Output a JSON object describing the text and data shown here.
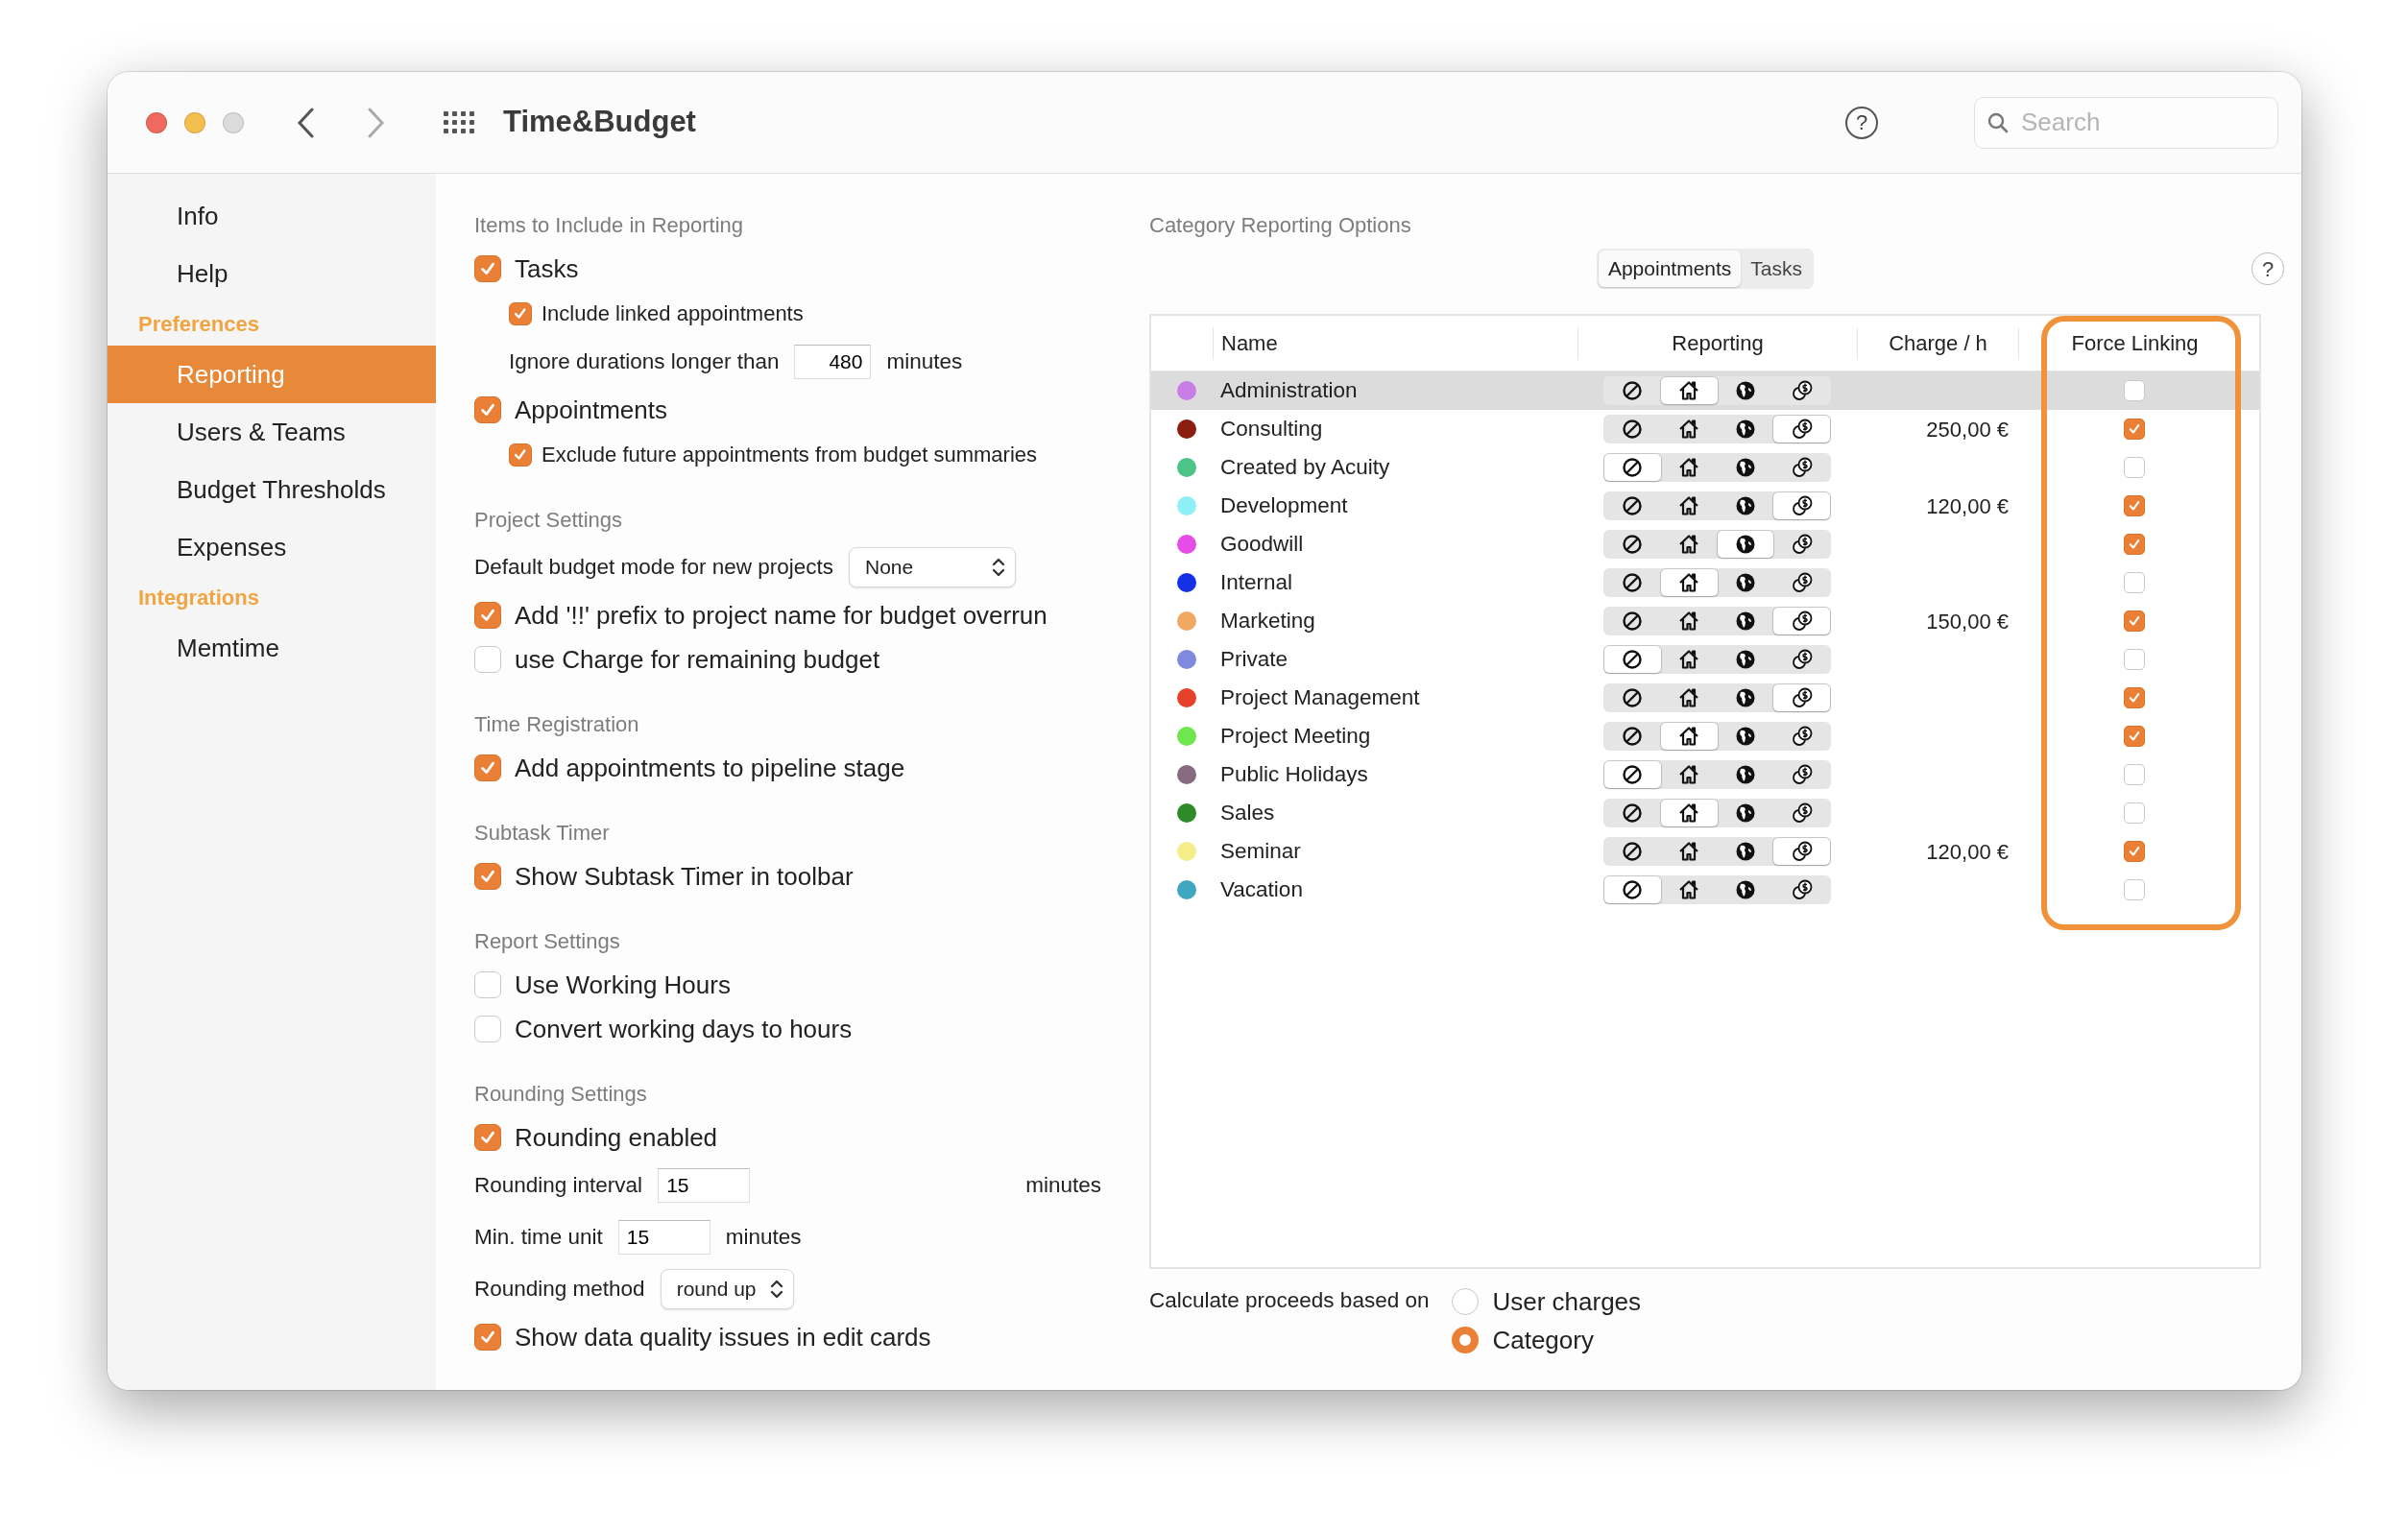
{
  "window": {
    "title": "Time&Budget"
  },
  "toolbar": {
    "help": "?",
    "search": {
      "placeholder": "Search"
    }
  },
  "sidebar": [
    {
      "kind": "item",
      "label": "Info",
      "selected": false
    },
    {
      "kind": "item",
      "label": "Help",
      "selected": false
    },
    {
      "kind": "header",
      "label": "Preferences"
    },
    {
      "kind": "item",
      "label": "Reporting",
      "selected": true
    },
    {
      "kind": "item",
      "label": "Users & Teams",
      "selected": false
    },
    {
      "kind": "item",
      "label": "Budget Thresholds",
      "selected": false
    },
    {
      "kind": "item",
      "label": "Expenses",
      "selected": false
    },
    {
      "kind": "header",
      "label": "Integrations"
    },
    {
      "kind": "item",
      "label": "Memtime",
      "selected": false
    }
  ],
  "settings": [
    {
      "kind": "heading",
      "label": "Items to Include in Reporting"
    },
    {
      "kind": "check",
      "label": "Tasks",
      "checked": true
    },
    {
      "kind": "subcheck",
      "label": "Include linked appointments",
      "checked": true
    },
    {
      "kind": "subnumber",
      "label": "Ignore durations longer than",
      "value": "480",
      "unit": "minutes"
    },
    {
      "kind": "check",
      "label": "Appointments",
      "checked": true
    },
    {
      "kind": "subcheck",
      "label": "Exclude future appointments from budget summaries",
      "checked": true
    },
    {
      "kind": "heading",
      "label": "Project Settings"
    },
    {
      "kind": "select",
      "label": "Default budget mode for new projects",
      "value": "None"
    },
    {
      "kind": "check",
      "label": "Add '!!' prefix to project name for budget overrun",
      "checked": true
    },
    {
      "kind": "check",
      "label": "use Charge for remaining budget",
      "checked": false
    },
    {
      "kind": "heading",
      "label": "Time Registration"
    },
    {
      "kind": "check",
      "label": "Add appointments to pipeline stage",
      "checked": true
    },
    {
      "kind": "heading",
      "label": "Subtask Timer"
    },
    {
      "kind": "check",
      "label": "Show Subtask Timer in toolbar",
      "checked": true
    },
    {
      "kind": "heading",
      "label": "Report Settings"
    },
    {
      "kind": "check",
      "label": "Use Working Hours",
      "checked": false
    },
    {
      "kind": "check",
      "label": "Convert working days to hours",
      "checked": false
    },
    {
      "kind": "heading",
      "label": "Rounding Settings"
    },
    {
      "kind": "check",
      "label": "Rounding enabled",
      "checked": true
    },
    {
      "kind": "number",
      "label": "Rounding interval",
      "value": "15",
      "unit": "minutes",
      "unit_far": true
    },
    {
      "kind": "number",
      "label": "Min. time unit",
      "value": "15",
      "unit": "minutes",
      "unit_far": false
    },
    {
      "kind": "select",
      "label": "Rounding method",
      "value": "round up"
    },
    {
      "kind": "check",
      "label": "Show data quality issues in edit cards",
      "checked": true
    }
  ],
  "categories": {
    "title": "Category Reporting Options",
    "help": "?",
    "tabs": [
      {
        "label": "Appointments",
        "selected": true
      },
      {
        "label": "Tasks",
        "selected": false
      }
    ],
    "columns": [
      {
        "label": "Name",
        "highlighted": false
      },
      {
        "label": "Reporting",
        "highlighted": false
      },
      {
        "label": "Charge / h",
        "highlighted": false
      },
      {
        "label": "Force Linking",
        "highlighted": true
      }
    ],
    "rows": [
      {
        "name": "Administration",
        "color": "#c87de6",
        "reporting": [
          {
            "selected": false
          },
          {
            "selected": true
          },
          {
            "selected": false
          },
          {
            "selected": false
          }
        ],
        "force_linking": false,
        "selected": true
      },
      {
        "name": "Consulting",
        "color": "#8a1d10",
        "reporting": [
          {
            "selected": false
          },
          {
            "selected": false
          },
          {
            "selected": false
          },
          {
            "selected": true
          }
        ],
        "charge": "250,00 €",
        "force_linking": true,
        "selected": false
      },
      {
        "name": "Created by Acuity",
        "color": "#4cc488",
        "reporting": [
          {
            "selected": true
          },
          {
            "selected": false
          },
          {
            "selected": false
          },
          {
            "selected": false
          }
        ],
        "force_linking": false,
        "selected": false
      },
      {
        "name": "Development",
        "color": "#8eeff4",
        "reporting": [
          {
            "selected": false
          },
          {
            "selected": false
          },
          {
            "selected": false
          },
          {
            "selected": true
          }
        ],
        "charge": "120,00 €",
        "force_linking": true,
        "selected": false
      },
      {
        "name": "Goodwill",
        "color": "#e64de6",
        "reporting": [
          {
            "selected": false
          },
          {
            "selected": false
          },
          {
            "selected": true
          },
          {
            "selected": false
          }
        ],
        "force_linking": true,
        "selected": false
      },
      {
        "name": "Internal",
        "color": "#1431e6",
        "reporting": [
          {
            "selected": false
          },
          {
            "selected": true
          },
          {
            "selected": false
          },
          {
            "selected": false
          }
        ],
        "force_linking": false,
        "selected": false
      },
      {
        "name": "Marketing",
        "color": "#f0a862",
        "reporting": [
          {
            "selected": false
          },
          {
            "selected": false
          },
          {
            "selected": false
          },
          {
            "selected": true
          }
        ],
        "charge": "150,00 €",
        "force_linking": true,
        "selected": false
      },
      {
        "name": "Private",
        "color": "#7f89de",
        "reporting": [
          {
            "selected": true
          },
          {
            "selected": false
          },
          {
            "selected": false
          },
          {
            "selected": false
          }
        ],
        "force_linking": false,
        "selected": false
      },
      {
        "name": "Project Management",
        "color": "#e6412b",
        "reporting": [
          {
            "selected": false
          },
          {
            "selected": false
          },
          {
            "selected": false
          },
          {
            "selected": true
          }
        ],
        "force_linking": true,
        "selected": false
      },
      {
        "name": "Project Meeting",
        "color": "#6ee64e",
        "reporting": [
          {
            "selected": false
          },
          {
            "selected": true
          },
          {
            "selected": false
          },
          {
            "selected": false
          }
        ],
        "force_linking": true,
        "selected": false
      },
      {
        "name": "Public Holidays",
        "color": "#866a80",
        "reporting": [
          {
            "selected": true
          },
          {
            "selected": false
          },
          {
            "selected": false
          },
          {
            "selected": false
          }
        ],
        "force_linking": false,
        "selected": false
      },
      {
        "name": "Sales",
        "color": "#2f8a2a",
        "reporting": [
          {
            "selected": false
          },
          {
            "selected": true
          },
          {
            "selected": false
          },
          {
            "selected": false
          }
        ],
        "force_linking": false,
        "selected": false
      },
      {
        "name": "Seminar",
        "color": "#f4ee8a",
        "reporting": [
          {
            "selected": false
          },
          {
            "selected": false
          },
          {
            "selected": false
          },
          {
            "selected": true
          }
        ],
        "charge": "120,00 €",
        "force_linking": true,
        "selected": false
      },
      {
        "name": "Vacation",
        "color": "#3fa8c0",
        "reporting": [
          {
            "selected": true
          },
          {
            "selected": false
          },
          {
            "selected": false
          },
          {
            "selected": false
          }
        ],
        "force_linking": false,
        "selected": false
      }
    ]
  },
  "proceeds": {
    "label": "Calculate proceeds based on",
    "options": [
      {
        "label": "User charges",
        "selected": false
      },
      {
        "label": "Category",
        "selected": true
      }
    ]
  }
}
